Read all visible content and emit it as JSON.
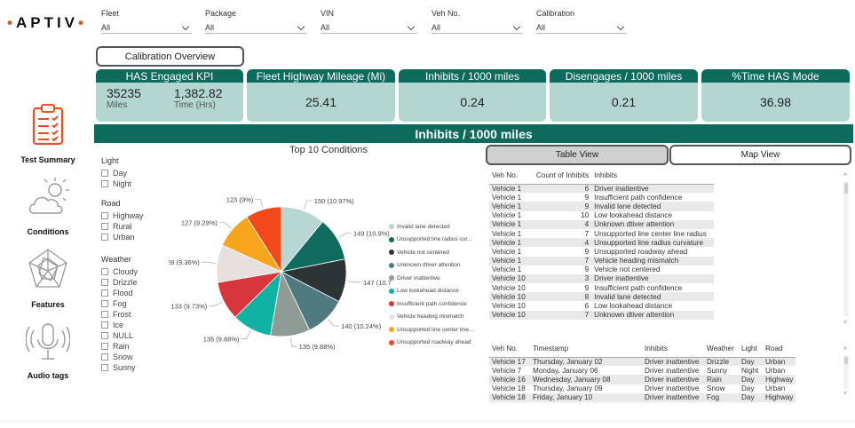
{
  "logo": {
    "left_dot": "•",
    "text": "APTIV",
    "right_dot": "•"
  },
  "filters": [
    {
      "label": "Fleet",
      "value": "All"
    },
    {
      "label": "Package",
      "value": "All"
    },
    {
      "label": "VIN",
      "value": "All"
    },
    {
      "label": "Veh No.",
      "value": "All"
    },
    {
      "label": "Calibration",
      "value": "All"
    }
  ],
  "calibration_overview_label": "Calibration Overview",
  "kpis": {
    "has_engaged": {
      "title": "HAS Engaged KPI",
      "miles_value": "35235",
      "miles_label": "Miles",
      "time_value": "1,382.82",
      "time_label": "Time (Hrs)"
    },
    "fleet_mileage": {
      "title": "Fleet Highway Mileage (Mi)",
      "value": "25.41"
    },
    "inhibits": {
      "title": "Inhibits / 1000 miles",
      "value": "0.24"
    },
    "disengages": {
      "title": "Disengages / 1000 miles",
      "value": "0.21"
    },
    "time_has": {
      "title": "%Time HAS Mode",
      "value": "36.98"
    }
  },
  "banner_title": "Inhibits / 1000 miles",
  "nav": [
    {
      "label": "Test Summary",
      "icon": "clipboard-checklist-icon"
    },
    {
      "label": "Conditions",
      "icon": "cloud-sun-icon"
    },
    {
      "label": "Features",
      "icon": "radar-star-icon"
    },
    {
      "label": "Audio tags",
      "icon": "microphone-icon"
    }
  ],
  "slicers": {
    "light": {
      "title": "Light",
      "items": [
        "Day",
        "Night"
      ]
    },
    "road": {
      "title": "Road",
      "items": [
        "Highway",
        "Rural",
        "Urban"
      ]
    },
    "weather": {
      "title": "Weather",
      "items": [
        "Cloudy",
        "Drizzle",
        "Flood",
        "Fog",
        "Frost",
        "Ice",
        "NULL",
        "Rain",
        "Snow",
        "Sunny"
      ]
    }
  },
  "chart_data": {
    "type": "pie",
    "title": "Top 10 Conditions",
    "slices": [
      {
        "label": "Invalid lane detected",
        "value": 150,
        "text": "150 (10.97%)",
        "color": "#b8d6d2"
      },
      {
        "label": "Unsupported line radius cur...",
        "value": 149,
        "text": "149 (10.9%)",
        "color": "#0f6b5d"
      },
      {
        "label": "Vehicle not centered",
        "value": 147,
        "text": "147 (10.75%)",
        "color": "#2d3436"
      },
      {
        "label": "Unknown dtiver attention",
        "value": 140,
        "text": "140 (10.24%)",
        "color": "#4e7a80"
      },
      {
        "label": "Driver inattentive",
        "value": 135,
        "text": "135 (9.88%)",
        "color": "#8f9c95"
      },
      {
        "label": "Low lookahead distance",
        "value": 135,
        "text": "135 (9.88%)",
        "color": "#10b3a3"
      },
      {
        "label": "Insufficient path confidence",
        "value": 133,
        "text": "133 (9.73%)",
        "color": "#d7363c"
      },
      {
        "label": "Vehicle heading mismatch",
        "value": 128,
        "text": "128 (9.36%)",
        "color": "#e6e1dc"
      },
      {
        "label": "Unsupported line center line...",
        "value": 127,
        "text": "127 (9.29%)",
        "color": "#f6a51c"
      },
      {
        "label": "Unsupported roadway ahead",
        "value": 123,
        "text": "123 (9%)",
        "color": "#f2491b"
      }
    ]
  },
  "view_buttons": {
    "table": "Table View",
    "map": "Map View"
  },
  "table1": {
    "headers": [
      "Veh No.",
      "Count of Inhibits",
      "Inhibits"
    ],
    "rows": [
      [
        "Vehicle 1",
        "6",
        "Driver inattentive"
      ],
      [
        "Vehicle 1",
        "9",
        "Insufficient path confidence"
      ],
      [
        "Vehicle 1",
        "9",
        "Invalid lane detected"
      ],
      [
        "Vehicle 1",
        "10",
        "Low lookahead distance"
      ],
      [
        "Vehicle 1",
        "4",
        "Unknown dtiver attention"
      ],
      [
        "Vehicle 1",
        "7",
        "Unsupported line center line radius"
      ],
      [
        "Vehicle 1",
        "4",
        "Unsupported line radius curvature"
      ],
      [
        "Vehicle 1",
        "9",
        "Unsupported roadway ahead"
      ],
      [
        "Vehicle 1",
        "7",
        "Vehicle heading mismatch"
      ],
      [
        "Vehicle 1",
        "9",
        "Vehicle not centered"
      ],
      [
        "Vehicle 10",
        "3",
        "Driver inattentive"
      ],
      [
        "Vehicle 10",
        "9",
        "Insufficient path confidence"
      ],
      [
        "Vehicle 10",
        "8",
        "Invalid lane detected"
      ],
      [
        "Vehicle 10",
        "6",
        "Low lookahead distance"
      ],
      [
        "Vehicle 10",
        "7",
        "Unknown dtiver attention"
      ]
    ]
  },
  "table2": {
    "headers": [
      "Veh No.",
      "Timestamp",
      "Inhibits",
      "Weather",
      "Light",
      "Road"
    ],
    "rows": [
      [
        "Vehicle 17",
        "Thursday, January 02",
        "Driver inattentive",
        "Drizzle",
        "Day",
        "Urban"
      ],
      [
        "Vehicle 7",
        "Monday, January 06",
        "Driver inattentive",
        "Sunny",
        "Night",
        "Urban"
      ],
      [
        "Vehicle 16",
        "Wednesday, January 08",
        "Driver inattentive",
        "Rain",
        "Day",
        "Highway"
      ],
      [
        "Vehicle 18",
        "Thursday, January 09",
        "Driver inattentive",
        "Snow",
        "Day",
        "Urban"
      ],
      [
        "Vehicle 18",
        "Friday, January 10",
        "Driver inattentive",
        "Fog",
        "Day",
        "Highway"
      ]
    ]
  }
}
